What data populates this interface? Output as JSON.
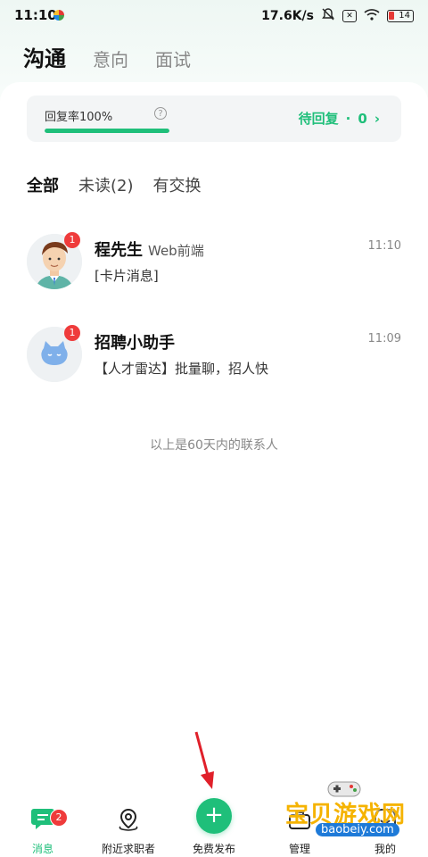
{
  "status_bar": {
    "time": "11:10",
    "network_speed": "17.6K/s",
    "battery": "14"
  },
  "top_tabs": [
    "沟通",
    "意向",
    "面试"
  ],
  "reply_card": {
    "label": "回复率100%",
    "progress_percent": 100,
    "pending_label": "待回复",
    "pending_count": "0",
    "accent_color": "#1fbf7a"
  },
  "filters": {
    "all": "全部",
    "unread": "未读(2)",
    "exchanged": "有交换"
  },
  "conversations": [
    {
      "name": "程先生",
      "role": "Web前端",
      "time": "11:10",
      "message": "[卡片消息]",
      "badge": "1"
    },
    {
      "name": "招聘小助手",
      "role": "",
      "time": "11:09",
      "message": "【人才雷达】批量聊，招人快",
      "badge": "1"
    }
  ],
  "footer_note": "以上是60天内的联系人",
  "bottom_nav": {
    "messages": {
      "label": "消息",
      "badge": "2"
    },
    "nearby": {
      "label": "附近求职者"
    },
    "post": {
      "label": "免费发布"
    },
    "manage": {
      "label": "管理"
    },
    "mine": {
      "label": "我的"
    }
  },
  "watermark": {
    "title": "宝贝游戏网",
    "url": "baobeiy.com"
  }
}
